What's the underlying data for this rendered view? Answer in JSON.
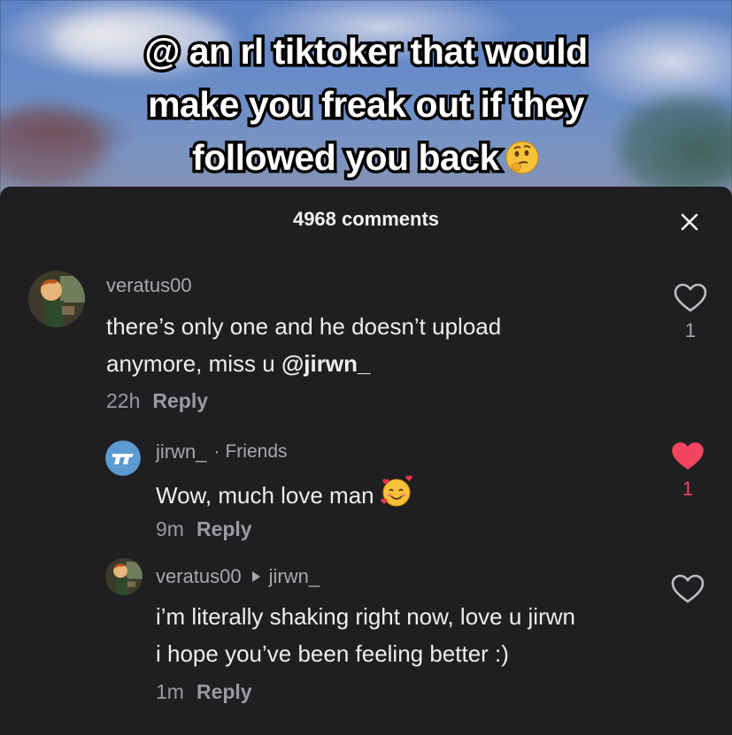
{
  "video": {
    "caption_lines": [
      "@ an rl tiktoker that would",
      "make you freak out if they",
      "followed you back"
    ],
    "caption_emoji": "thinking-face-emoji"
  },
  "comments_panel": {
    "title": "4968 comments",
    "close_icon": "close-icon"
  },
  "comments": [
    {
      "username": "veratus00",
      "text_line1": "there’s only one and he doesn’t upload",
      "text_line2_prefix": "anymore, miss u ",
      "mention": "@jirwn_",
      "time": "22h",
      "reply_label": "Reply",
      "like_count": "1",
      "liked": false
    },
    {
      "username": "jirwn_",
      "separator": "·",
      "badge": "Friends",
      "text": "Wow, much love man",
      "emoji": "smiling-face-with-hearts-emoji",
      "time": "9m",
      "reply_label": "Reply",
      "like_count": "1",
      "liked": true,
      "like_color": "#f2455f"
    },
    {
      "username": "veratus00",
      "reply_to": "jirwn_",
      "text_line1": "i’m literally shaking right now, love u jirwn",
      "text_line2": "i hope you’ve been feeling better :)",
      "time": "1m",
      "reply_label": "Reply",
      "liked": false
    }
  ]
}
